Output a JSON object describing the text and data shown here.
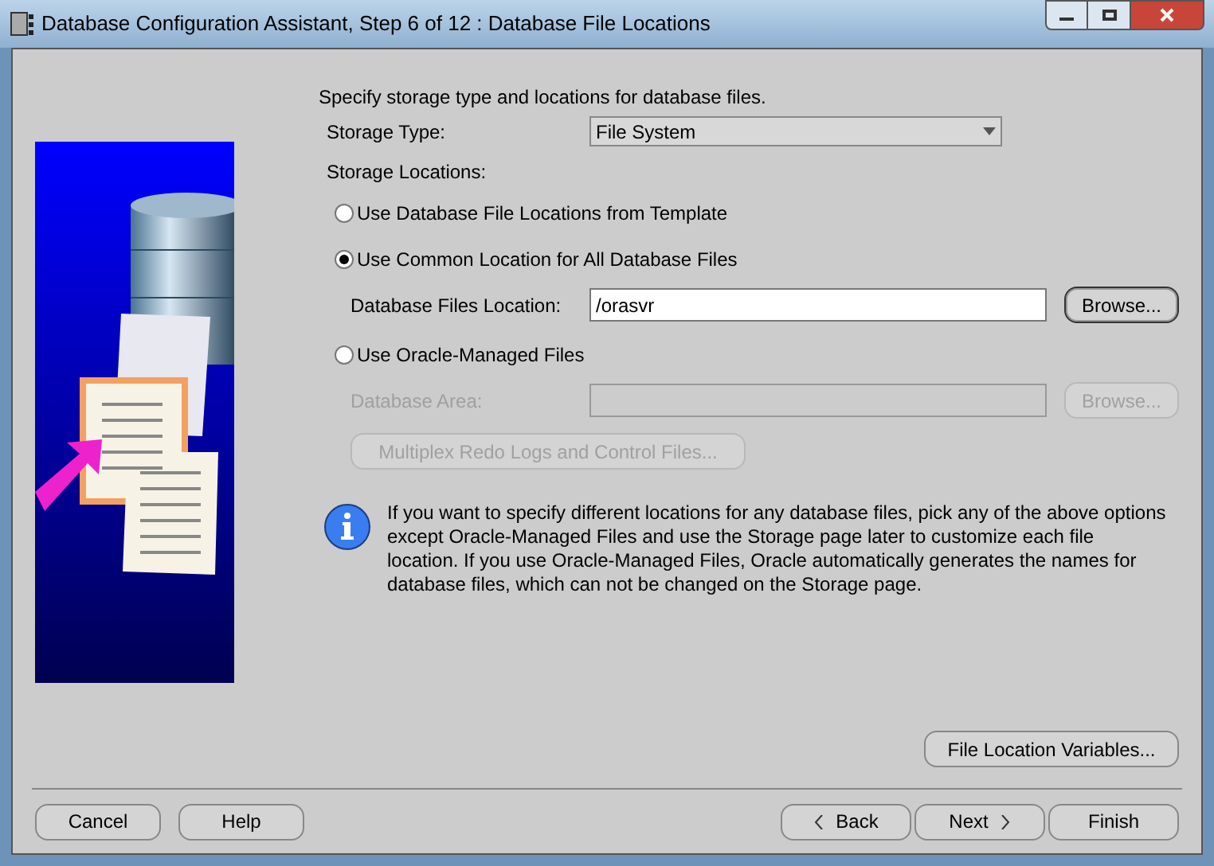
{
  "window": {
    "title": "Database Configuration Assistant, Step 6 of 12 : Database File Locations"
  },
  "intro": "Specify storage type and locations for database files.",
  "storage_type": {
    "label": "Storage Type:",
    "value": "File System"
  },
  "storage_locations_label": "Storage Locations:",
  "options": [
    {
      "label": "Use Database File Locations from Template",
      "selected": false
    },
    {
      "label": "Use Common Location for All Database Files",
      "selected": true,
      "field": {
        "label": "Database Files Location:",
        "value": "/orasvr",
        "button": "Browse...",
        "disabled": false
      }
    },
    {
      "label": "Use Oracle-Managed Files",
      "selected": false,
      "field": {
        "label": "Database Area:",
        "button": "Browse...",
        "disabled": true
      },
      "extra_button": {
        "label": "Multiplex Redo Logs and Control Files...",
        "disabled": true
      }
    }
  ],
  "info": "If you want to specify different locations for any database files, pick any of the above options except Oracle-Managed Files and use the Storage page later to customize each file location. If you use Oracle-Managed Files, Oracle automatically generates the names for database files, which can not be changed on the Storage page.",
  "file_location_button": "File Location Variables...",
  "footer_left": [
    {
      "label": "Cancel"
    },
    {
      "label": "Help"
    }
  ],
  "footer_right": [
    {
      "label": "Back",
      "kind": "back"
    },
    {
      "label": "Next",
      "kind": "next"
    },
    {
      "label": "Finish",
      "kind": "plain"
    }
  ]
}
